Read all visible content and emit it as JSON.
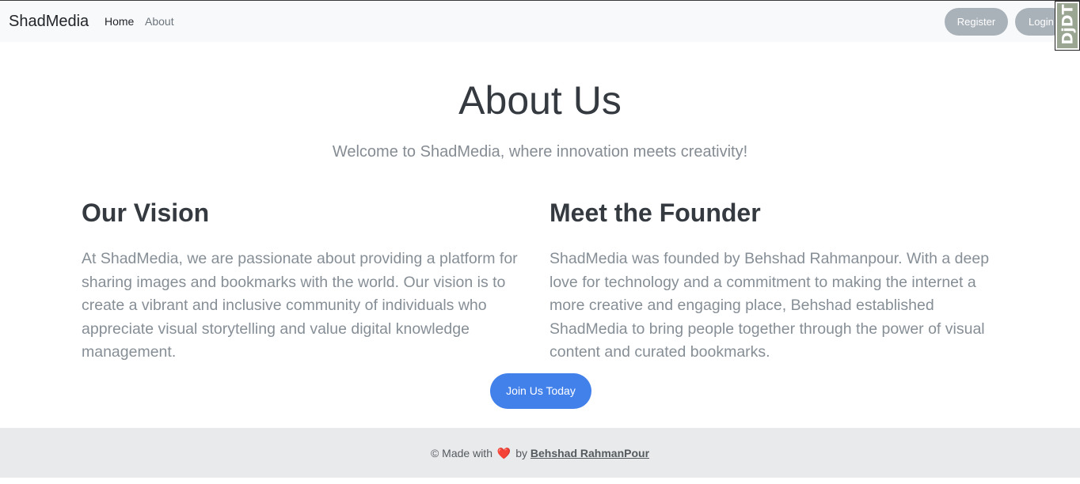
{
  "navbar": {
    "brand": "ShadMedia",
    "links": [
      {
        "label": "Home"
      },
      {
        "label": "About"
      }
    ],
    "register_label": "Register",
    "login_label": "Login"
  },
  "debug_toolbar": {
    "label": "DjDT"
  },
  "hero": {
    "title": "About Us",
    "lead": "Welcome to ShadMedia, where innovation meets creativity!"
  },
  "sections": [
    {
      "heading": "Our Vision",
      "body": "At ShadMedia, we are passionate about providing a platform for sharing images and bookmarks with the world. Our vision is to create a vibrant and inclusive community of individuals who appreciate visual storytelling and value digital knowledge management."
    },
    {
      "heading": "Meet the Founder",
      "body": "ShadMedia was founded by Behshad Rahmanpour. With a deep love for technology and a commitment to making the internet a more creative and engaging place, Behshad established ShadMedia to bring people together through the power of visual content and curated bookmarks."
    }
  ],
  "cta": {
    "label": "Join Us Today"
  },
  "footer": {
    "prefix": "© Made with",
    "heart": "❤️",
    "by": "by",
    "author": "Behshad RahmanPour"
  },
  "colors": {
    "primary": "#4381ea",
    "secondary_button": "#a9b1b9",
    "navbar_bg": "#f8f9fa",
    "footer_bg": "#e9eaeb",
    "heart": "#e0363c"
  }
}
